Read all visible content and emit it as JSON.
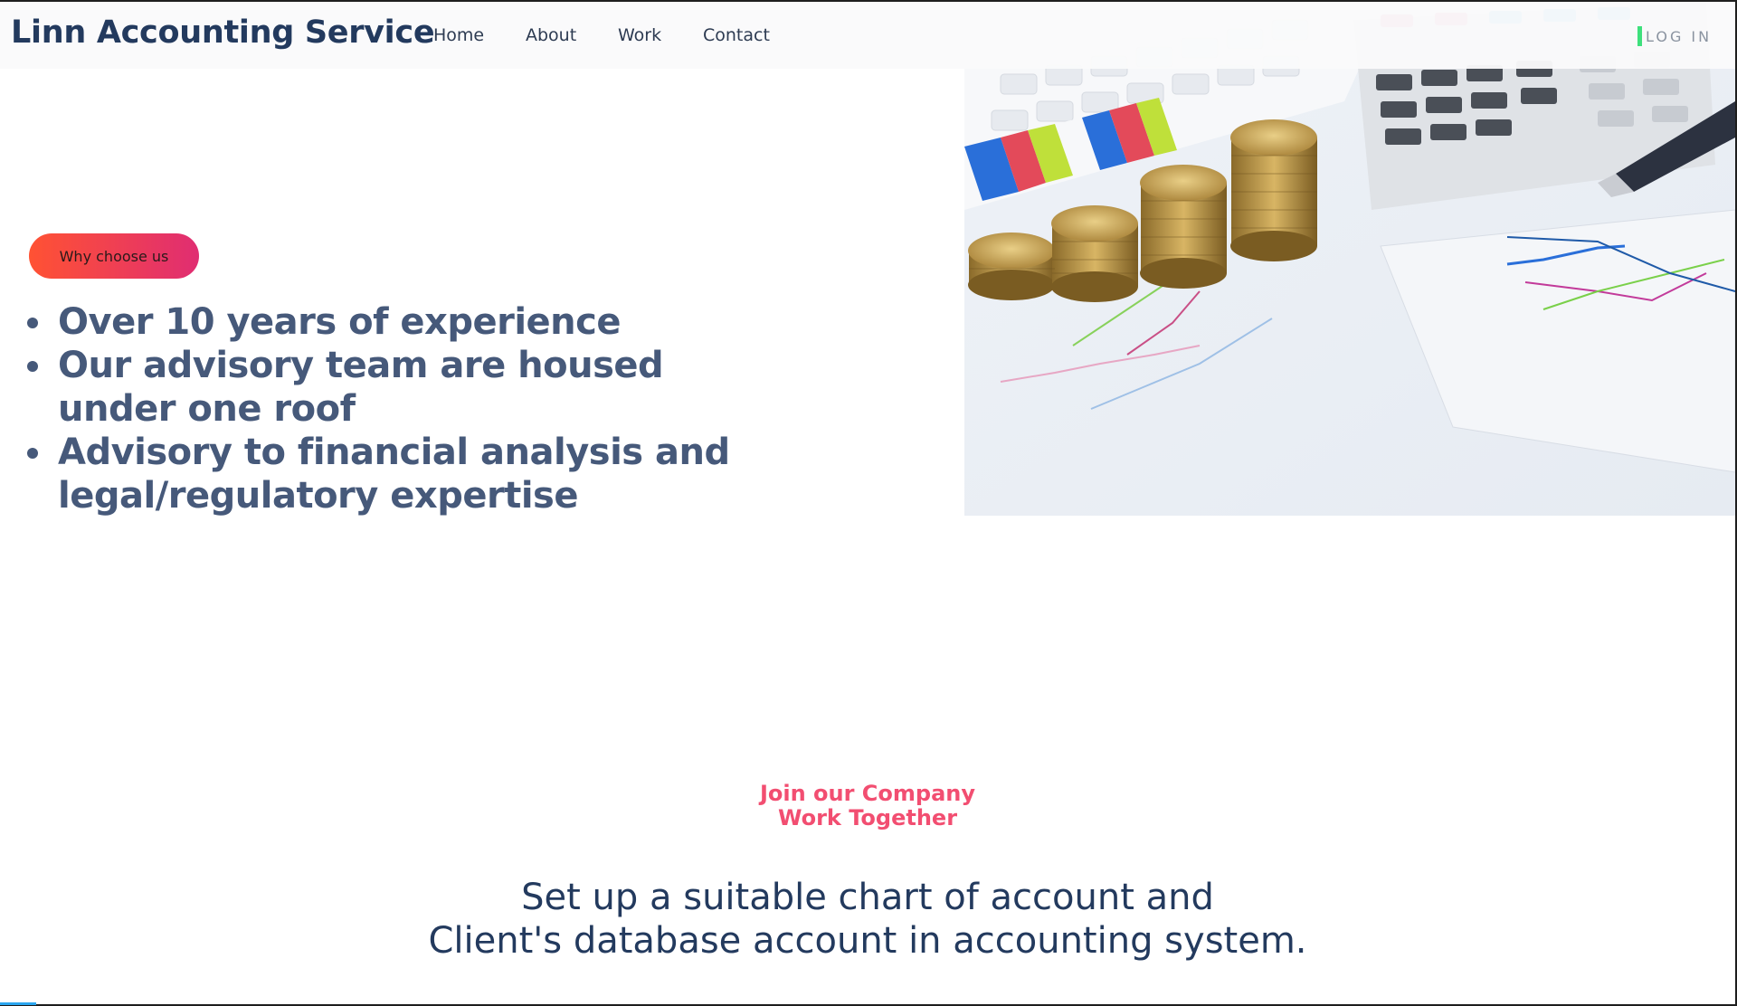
{
  "header": {
    "brand": "Linn Accounting Service",
    "nav": [
      {
        "label": "Home"
      },
      {
        "label": "About"
      },
      {
        "label": "Work"
      },
      {
        "label": "Contact"
      }
    ],
    "login_label": "LOG IN"
  },
  "hero": {
    "pill_label": "Why choose us",
    "features": [
      {
        "line1": "Over 10 years of experience",
        "line2": ""
      },
      {
        "line1": "Our advisory team are housed",
        "line2": "under one roof"
      },
      {
        "line1": "Advisory to financial analysis and",
        "line2": "legal/regulatory expertise"
      }
    ],
    "image_subject": "coins, calculator, keyboard and charts on desk"
  },
  "join": {
    "line1": "Join our Company",
    "line2": "Work Together"
  },
  "tagline": {
    "line1": "Set up a suitable chart of account and",
    "line2": "Client's database account in accounting system."
  },
  "colors": {
    "brand": "#233a5e",
    "accent_pink": "#f24e71",
    "pill_start": "#ff5233",
    "pill_end": "#e02d72",
    "login_bar": "#3ee07c",
    "feature_text": "#46597a"
  }
}
